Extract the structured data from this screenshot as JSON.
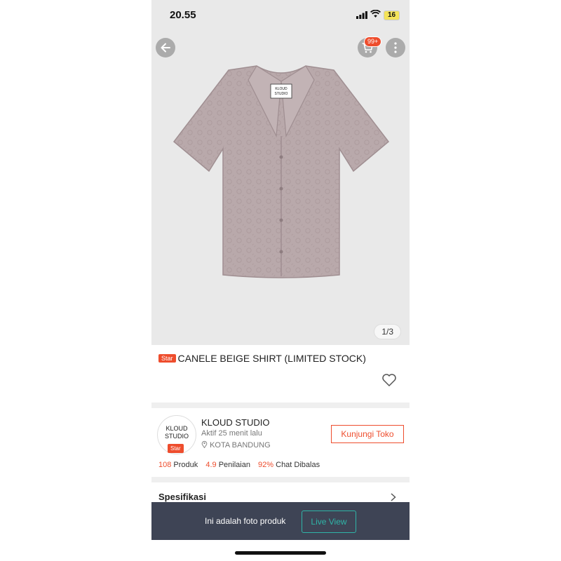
{
  "status_bar": {
    "time": "20.55",
    "battery": "16"
  },
  "header": {
    "cart_badge": "99+"
  },
  "gallery": {
    "counter": "1/3",
    "shirt_label": "KLOUD STUDIO"
  },
  "product": {
    "tag": "Star",
    "title": "CANELE BEIGE SHIRT (LIMITED STOCK)"
  },
  "shop": {
    "logo_text": "KLOUD STUDIO",
    "logo_tag": "Star",
    "name": "KLOUD STUDIO",
    "active": "Aktif 25 menit lalu",
    "location": "KOTA BANDUNG",
    "visit_label": "Kunjungi Toko",
    "stats": {
      "products_num": "108",
      "products_label": "Produk",
      "rating_num": "4.9",
      "rating_label": "Penilaian",
      "chat_num": "92%",
      "chat_label": "Chat Dibalas"
    }
  },
  "spec": {
    "label": "Spesifikasi"
  },
  "banner": {
    "message": "Ini adalah foto produk",
    "live_label": "Live View"
  },
  "colors": {
    "accent": "#ee4d2d",
    "banner_bg": "#3e4455",
    "live": "#2fb5a8",
    "shirt": "#b9a9ab"
  }
}
